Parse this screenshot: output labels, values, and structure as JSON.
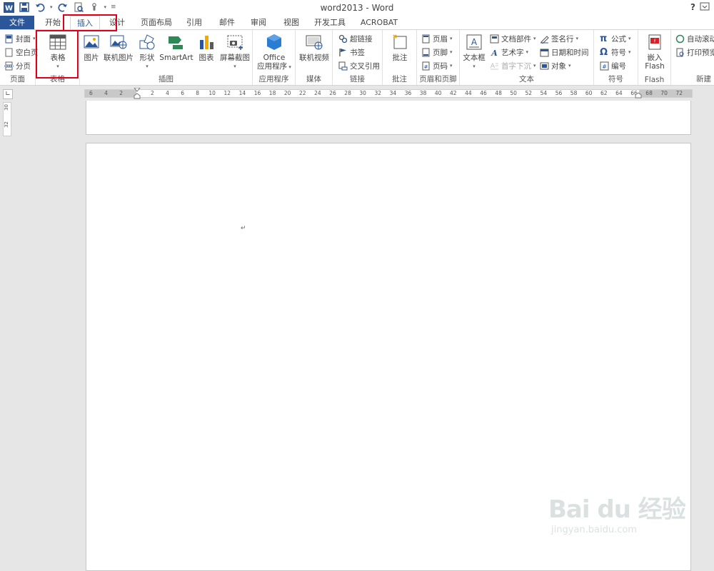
{
  "window": {
    "title": "word2013 - Word",
    "help": "?"
  },
  "tabs": [
    "文件",
    "开始",
    "插入",
    "设计",
    "页面布局",
    "引用",
    "邮件",
    "审阅",
    "视图",
    "开发工具",
    "ACROBAT"
  ],
  "ribbon": {
    "pages": {
      "label": "页面",
      "items": [
        "封面",
        "空白页",
        "分页"
      ]
    },
    "tables": {
      "label": "表格",
      "button": "表格"
    },
    "illustrations": {
      "label": "插图",
      "buttons": [
        "图片",
        "联机图片",
        "形状",
        "SmartArt",
        "图表",
        "屏幕截图"
      ]
    },
    "apps": {
      "label": "应用程序",
      "line1": "Office",
      "line2": "应用程序"
    },
    "media": {
      "label": "媒体",
      "button": "联机视频"
    },
    "links": {
      "label": "链接",
      "items": [
        "超链接",
        "书签",
        "交叉引用"
      ]
    },
    "comments": {
      "label": "批注",
      "button": "批注"
    },
    "headerfooter": {
      "label": "页眉和页脚",
      "items": [
        "页眉",
        "页脚",
        "页码"
      ]
    },
    "text": {
      "label": "文本",
      "textbox": "文本框",
      "items": [
        "文档部件",
        "艺术字",
        "首字下沉",
        "签名行",
        "日期和时间",
        "对象"
      ]
    },
    "symbols": {
      "label": "符号",
      "items": [
        "公式",
        "符号",
        "编号"
      ]
    },
    "flash": {
      "label": "Flash",
      "line1": "嵌入",
      "line2": "Flash"
    },
    "newgroup": {
      "label": "新建",
      "items": [
        "自动滚动",
        "打印预览"
      ]
    }
  },
  "ruler": {
    "left_numbers": [
      "6",
      "4",
      "2"
    ],
    "numbers": [
      "2",
      "4",
      "6",
      "8",
      "10",
      "12",
      "14",
      "16",
      "18",
      "20",
      "22",
      "24",
      "26",
      "28",
      "30",
      "32",
      "34",
      "36",
      "38",
      "40",
      "42",
      "44",
      "46",
      "48",
      "50",
      "52",
      "54",
      "56",
      "58",
      "60",
      "62",
      "64",
      "66",
      "68",
      "70",
      "72"
    ],
    "vertical": [
      "32",
      "30"
    ]
  },
  "document": {
    "paragraph_mark": "↵"
  },
  "watermark": {
    "logo": "Bai du 经验",
    "sub": "jingyan.baidu.com"
  },
  "colors": {
    "file_tab": "#2b579a",
    "highlight": "#e0001b"
  }
}
